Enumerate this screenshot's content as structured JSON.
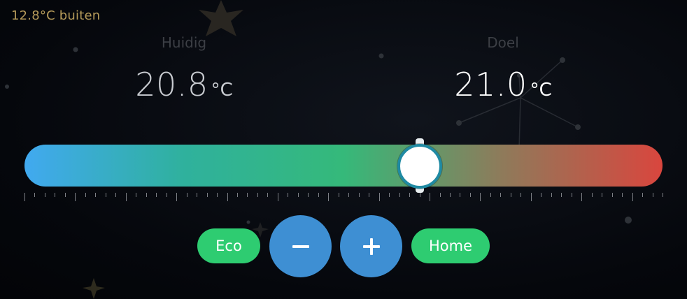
{
  "outside": {
    "text": "12.8°C buiten",
    "color": "#b59a5a"
  },
  "current": {
    "label": "Huidig",
    "value": "20.8",
    "unit": "°C"
  },
  "target": {
    "label": "Doel",
    "value": "21.0",
    "unit": "°C"
  },
  "slider": {
    "value_fraction": 0.62,
    "gradient_colors": [
      "#41a9f0",
      "#2fb19d",
      "#35b97a",
      "#8f7a5a",
      "#d9463e"
    ],
    "thumb_border_color": "#1f8aa3"
  },
  "buttons": {
    "eco": {
      "label": "Eco",
      "color": "#2ecc71"
    },
    "minus": {
      "icon": "minus-icon",
      "color": "#3e8fd3"
    },
    "plus": {
      "icon": "plus-icon",
      "color": "#3e8fd3"
    },
    "home": {
      "label": "Home",
      "color": "#2ecc71"
    }
  }
}
